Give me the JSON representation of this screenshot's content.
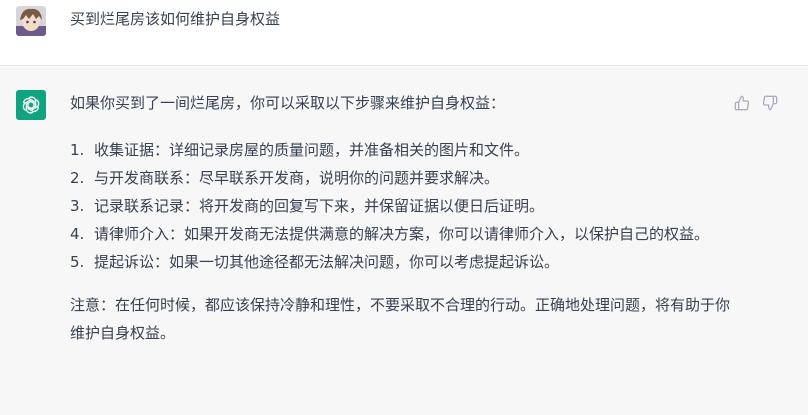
{
  "user": {
    "message": "买到烂尾房该如何维护自身权益"
  },
  "assistant": {
    "intro": "如果你买到了一间烂尾房，你可以采取以下步骤来维护自身权益：",
    "steps": [
      {
        "num": "1.",
        "text": "收集证据：详细记录房屋的质量问题，并准备相关的图片和文件。"
      },
      {
        "num": "2.",
        "text": "与开发商联系：尽早联系开发商，说明你的问题并要求解决。"
      },
      {
        "num": "3.",
        "text": "记录联系记录：将开发商的回复写下来，并保留证据以便日后证明。"
      },
      {
        "num": "4.",
        "text": "请律师介入：如果开发商无法提供满意的解决方案，你可以请律师介入，以保护自己的权益。"
      },
      {
        "num": "5.",
        "text": "提起诉讼：如果一切其他途径都无法解决问题，你可以考虑提起诉讼。"
      }
    ],
    "note": "注意：在任何时候，都应该保持冷静和理性，不要采取不合理的行动。正确地处理问题，将有助于你维护自身权益。"
  },
  "icons": {
    "assistant_logo": "openai-logo-icon",
    "thumbs_up": "thumbs-up-icon",
    "thumbs_down": "thumbs-down-icon"
  },
  "colors": {
    "assistant_avatar_bg": "#10a37f",
    "response_bg": "#f7f7f8",
    "text": "#374151",
    "icon": "#acacbe"
  }
}
